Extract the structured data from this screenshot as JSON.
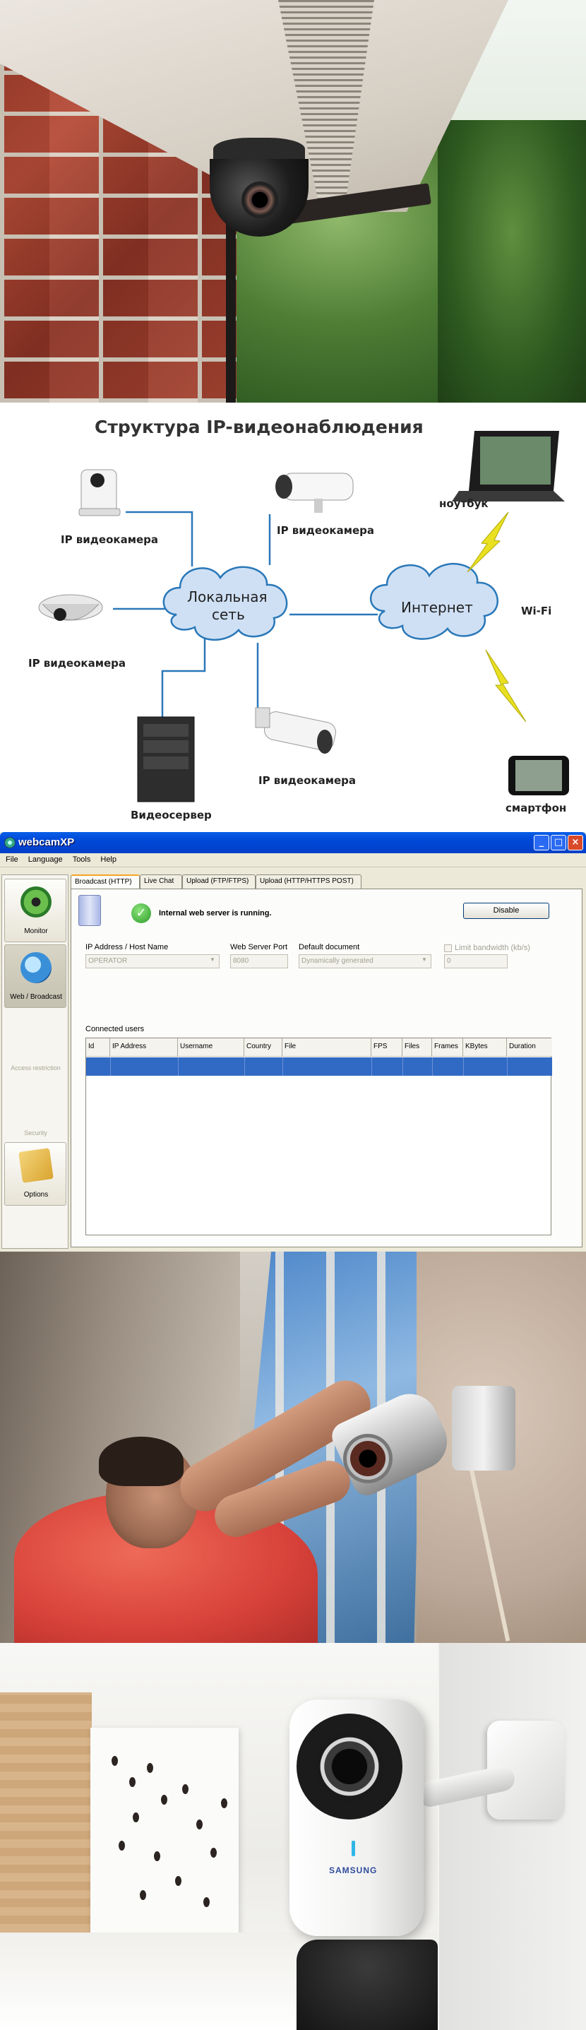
{
  "diagram": {
    "title": "Структура IP-видеонаблюдения",
    "nodes": {
      "ipcam_top_left": "IP видеокамера",
      "ipcam_top_mid": "IP видеокамера",
      "ipcam_left": "IP видеокамера",
      "ipcam_bottom": "IP видеокамера",
      "lan_line1": "Локальная",
      "lan_line2": "сеть",
      "internet": "Интернет",
      "laptop": "ноутбук",
      "wifi": "Wi-Fi",
      "server": "Видеосервер",
      "smartphone": "смартфон"
    },
    "colors": {
      "line": "#2a78b8",
      "cloud": "#cfe0f5",
      "bolt": "#e8e020"
    }
  },
  "webcamxp": {
    "title": "webcamXP",
    "menu": [
      "File",
      "Language",
      "Tools",
      "Help"
    ],
    "sidebar": {
      "monitor": "Monitor",
      "web_broadcast": "Web / Broadcast",
      "access_restriction": "Access restriction",
      "security": "Security",
      "options": "Options"
    },
    "tabs": [
      "Broadcast (HTTP)",
      "Live Chat",
      "Upload (FTP/FTPS)",
      "Upload (HTTP/HTTPS POST)"
    ],
    "status": "Internal web server is running.",
    "disable_button": "Disable",
    "fields": {
      "ip_label": "IP Address / Host Name",
      "ip_value": "OPERATOR",
      "port_label": "Web Server Port",
      "port_value": "8080",
      "doc_label": "Default document",
      "doc_value": "Dynamically generated",
      "limit_label": "Limit bandwidth (kb/s)",
      "limit_value": "0"
    },
    "connected_users_label": "Connected users",
    "columns": [
      "Id",
      "IP Address",
      "Username",
      "Country",
      "File",
      "FPS",
      "Files",
      "Frames",
      "KBytes",
      "Duration"
    ],
    "window_buttons": {
      "minimize": "_",
      "maximize": "□",
      "close": "×"
    }
  },
  "photo_brand": "SAMSUNG"
}
